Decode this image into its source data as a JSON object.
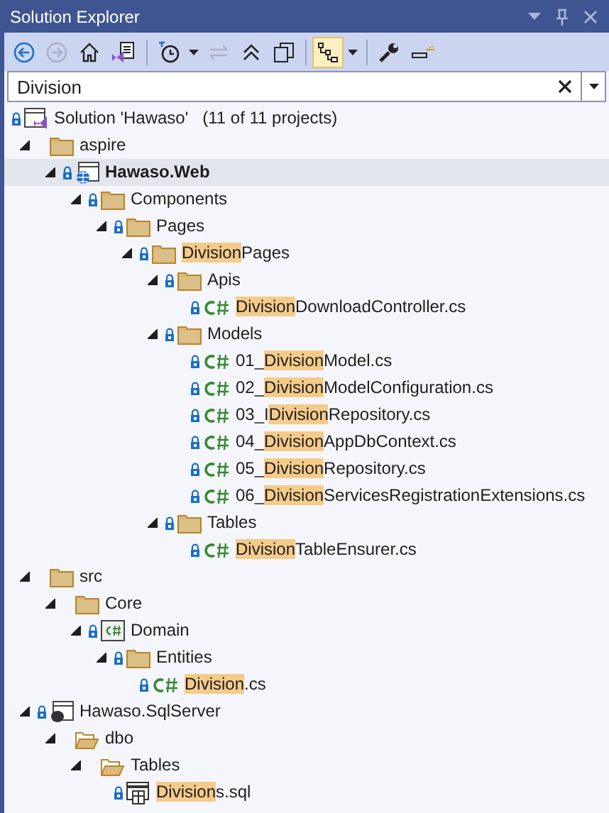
{
  "window": {
    "title": "Solution Explorer"
  },
  "toolbar": [
    {
      "kind": "back",
      "disabled": false,
      "selected": false
    },
    {
      "kind": "forward",
      "disabled": true,
      "selected": false
    },
    {
      "kind": "home",
      "disabled": false,
      "selected": false
    },
    {
      "kind": "switch-views",
      "disabled": false,
      "selected": false
    },
    {
      "kind": "sep"
    },
    {
      "kind": "history",
      "disabled": false,
      "selected": false
    },
    {
      "kind": "dropdown",
      "disabled": false,
      "selected": false
    },
    {
      "kind": "sync",
      "disabled": true,
      "selected": false
    },
    {
      "kind": "collapse",
      "disabled": false,
      "selected": false
    },
    {
      "kind": "copy",
      "disabled": false,
      "selected": false
    },
    {
      "kind": "sep"
    },
    {
      "kind": "tree-filter",
      "disabled": false,
      "selected": true
    },
    {
      "kind": "dropdown",
      "disabled": false,
      "selected": false
    },
    {
      "kind": "sep"
    },
    {
      "kind": "wrench",
      "disabled": false,
      "selected": false
    },
    {
      "kind": "preview",
      "disabled": false,
      "selected": false
    }
  ],
  "search": {
    "value": "Division"
  },
  "tree": [
    {
      "kind": "solution",
      "locked": true,
      "selected": false,
      "bold": false,
      "label": [
        {
          "text": "Solution 'Hawaso'   (11 of 11 projects)",
          "match": false
        }
      ],
      "children": [
        {
          "kind": "folder",
          "locked": false,
          "expanded": true,
          "selected": false,
          "bold": false,
          "label": [
            {
              "text": "aspire",
              "match": false
            }
          ],
          "children": [
            {
              "kind": "web-project",
              "locked": true,
              "expanded": true,
              "selected": true,
              "bold": true,
              "label": [
                {
                  "text": "Hawaso.Web",
                  "match": false
                }
              ],
              "children": [
                {
                  "kind": "folder",
                  "locked": true,
                  "expanded": true,
                  "selected": false,
                  "bold": false,
                  "label": [
                    {
                      "text": "Components",
                      "match": false
                    }
                  ],
                  "children": [
                    {
                      "kind": "folder",
                      "locked": true,
                      "expanded": true,
                      "selected": false,
                      "bold": false,
                      "label": [
                        {
                          "text": "Pages",
                          "match": false
                        }
                      ],
                      "children": [
                        {
                          "kind": "folder",
                          "locked": true,
                          "expanded": true,
                          "selected": false,
                          "bold": false,
                          "label": [
                            {
                              "text": "Division",
                              "match": true
                            },
                            {
                              "text": "Pages",
                              "match": false
                            }
                          ],
                          "children": [
                            {
                              "kind": "folder",
                              "locked": true,
                              "expanded": true,
                              "selected": false,
                              "bold": false,
                              "label": [
                                {
                                  "text": "Apis",
                                  "match": false
                                }
                              ],
                              "children": [
                                {
                                  "kind": "cs-file",
                                  "locked": true,
                                  "selected": false,
                                  "bold": false,
                                  "label": [
                                    {
                                      "text": "Division",
                                      "match": true
                                    },
                                    {
                                      "text": "DownloadController.cs",
                                      "match": false
                                    }
                                  ]
                                }
                              ]
                            },
                            {
                              "kind": "folder",
                              "locked": true,
                              "expanded": true,
                              "selected": false,
                              "bold": false,
                              "label": [
                                {
                                  "text": "Models",
                                  "match": false
                                }
                              ],
                              "children": [
                                {
                                  "kind": "cs-file",
                                  "locked": true,
                                  "selected": false,
                                  "bold": false,
                                  "label": [
                                    {
                                      "text": "01_",
                                      "match": false
                                    },
                                    {
                                      "text": "Division",
                                      "match": true
                                    },
                                    {
                                      "text": "Model.cs",
                                      "match": false
                                    }
                                  ]
                                },
                                {
                                  "kind": "cs-file",
                                  "locked": true,
                                  "selected": false,
                                  "bold": false,
                                  "label": [
                                    {
                                      "text": "02_",
                                      "match": false
                                    },
                                    {
                                      "text": "Division",
                                      "match": true
                                    },
                                    {
                                      "text": "ModelConfiguration.cs",
                                      "match": false
                                    }
                                  ]
                                },
                                {
                                  "kind": "cs-file",
                                  "locked": true,
                                  "selected": false,
                                  "bold": false,
                                  "label": [
                                    {
                                      "text": "03_I",
                                      "match": false
                                    },
                                    {
                                      "text": "Division",
                                      "match": true
                                    },
                                    {
                                      "text": "Repository.cs",
                                      "match": false
                                    }
                                  ]
                                },
                                {
                                  "kind": "cs-file",
                                  "locked": true,
                                  "selected": false,
                                  "bold": false,
                                  "label": [
                                    {
                                      "text": "04_",
                                      "match": false
                                    },
                                    {
                                      "text": "Division",
                                      "match": true
                                    },
                                    {
                                      "text": "AppDbContext.cs",
                                      "match": false
                                    }
                                  ]
                                },
                                {
                                  "kind": "cs-file",
                                  "locked": true,
                                  "selected": false,
                                  "bold": false,
                                  "label": [
                                    {
                                      "text": "05_",
                                      "match": false
                                    },
                                    {
                                      "text": "Division",
                                      "match": true
                                    },
                                    {
                                      "text": "Repository.cs",
                                      "match": false
                                    }
                                  ]
                                },
                                {
                                  "kind": "cs-file",
                                  "locked": true,
                                  "selected": false,
                                  "bold": false,
                                  "label": [
                                    {
                                      "text": "06_",
                                      "match": false
                                    },
                                    {
                                      "text": "Division",
                                      "match": true
                                    },
                                    {
                                      "text": "ServicesRegistrationExtensions.cs",
                                      "match": false
                                    }
                                  ]
                                }
                              ]
                            },
                            {
                              "kind": "folder",
                              "locked": true,
                              "expanded": true,
                              "selected": false,
                              "bold": false,
                              "label": [
                                {
                                  "text": "Tables",
                                  "match": false
                                }
                              ],
                              "children": [
                                {
                                  "kind": "cs-file",
                                  "locked": true,
                                  "selected": false,
                                  "bold": false,
                                  "label": [
                                    {
                                      "text": "Division",
                                      "match": true
                                    },
                                    {
                                      "text": "TableEnsurer.cs",
                                      "match": false
                                    }
                                  ]
                                }
                              ]
                            }
                          ]
                        }
                      ]
                    }
                  ]
                }
              ]
            }
          ]
        },
        {
          "kind": "folder",
          "locked": false,
          "expanded": true,
          "selected": false,
          "bold": false,
          "label": [
            {
              "text": "src",
              "match": false
            }
          ],
          "children": [
            {
              "kind": "folder",
              "locked": false,
              "expanded": true,
              "selected": false,
              "bold": false,
              "label": [
                {
                  "text": "Core",
                  "match": false
                }
              ],
              "children": [
                {
                  "kind": "cs-project",
                  "locked": true,
                  "expanded": true,
                  "selected": false,
                  "bold": false,
                  "label": [
                    {
                      "text": "Domain",
                      "match": false
                    }
                  ],
                  "children": [
                    {
                      "kind": "folder",
                      "locked": true,
                      "expanded": true,
                      "selected": false,
                      "bold": false,
                      "label": [
                        {
                          "text": "Entities",
                          "match": false
                        }
                      ],
                      "children": [
                        {
                          "kind": "cs-file",
                          "locked": true,
                          "selected": false,
                          "bold": false,
                          "label": [
                            {
                              "text": "Division",
                              "match": true
                            },
                            {
                              "text": ".cs",
                              "match": false
                            }
                          ]
                        }
                      ]
                    }
                  ]
                }
              ]
            }
          ]
        },
        {
          "kind": "sql-project",
          "locked": true,
          "expanded": true,
          "selected": false,
          "bold": false,
          "label": [
            {
              "text": "Hawaso.SqlServer",
              "match": false
            }
          ],
          "children": [
            {
              "kind": "open-folder",
              "locked": false,
              "expanded": true,
              "selected": false,
              "bold": false,
              "label": [
                {
                  "text": "dbo",
                  "match": false
                }
              ],
              "children": [
                {
                  "kind": "open-folder",
                  "locked": false,
                  "expanded": true,
                  "selected": false,
                  "bold": false,
                  "label": [
                    {
                      "text": "Tables",
                      "match": false
                    }
                  ],
                  "children": [
                    {
                      "kind": "sql-file",
                      "locked": true,
                      "selected": false,
                      "bold": false,
                      "label": [
                        {
                          "text": "Division",
                          "match": true
                        },
                        {
                          "text": "s.sql",
                          "match": false
                        }
                      ]
                    }
                  ]
                }
              ]
            }
          ]
        }
      ]
    }
  ]
}
